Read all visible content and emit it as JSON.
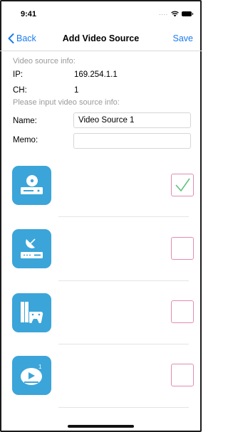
{
  "status_bar": {
    "time": "9:41"
  },
  "nav": {
    "back_label": "Back",
    "title": "Add Video Source",
    "save_label": "Save"
  },
  "info": {
    "section_title": "Video source info:",
    "ip_label": "IP:",
    "ip_value": "169.254.1.1",
    "ch_label": "CH:",
    "ch_value": "1"
  },
  "input": {
    "section_title": "Please input video source info:",
    "name_label": "Name:",
    "name_value": "Video Source 1",
    "memo_label": "Memo:",
    "memo_value": ""
  },
  "sources": [
    {
      "icon": "dvd-player-icon",
      "checked": true
    },
    {
      "icon": "satellite-receiver-icon",
      "checked": false
    },
    {
      "icon": "game-console-icon",
      "checked": false
    },
    {
      "icon": "media-box-icon",
      "checked": false
    }
  ],
  "colors": {
    "accent": "#1a7cf0",
    "tile": "#3ba5d9",
    "checkbox_border": "#e58ab3",
    "check_mark": "#5cc27a"
  }
}
